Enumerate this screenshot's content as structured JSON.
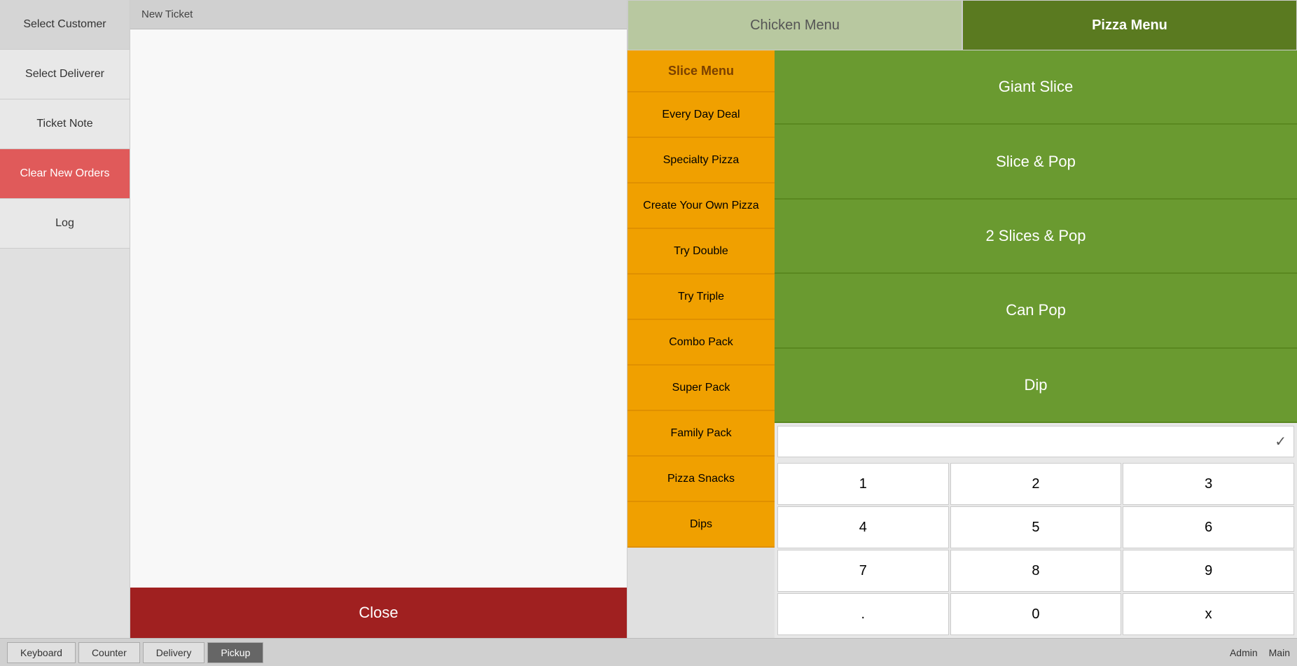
{
  "sidebar": {
    "buttons": [
      {
        "label": "Select Customer",
        "id": "select-customer",
        "active": false
      },
      {
        "label": "Select Deliverer",
        "id": "select-deliverer",
        "active": false
      },
      {
        "label": "Ticket Note",
        "id": "ticket-note",
        "active": false
      },
      {
        "label": "Clear New Orders",
        "id": "clear-new-orders",
        "active": true
      },
      {
        "label": "Log",
        "id": "log",
        "active": false
      }
    ]
  },
  "ticket": {
    "header": "New Ticket"
  },
  "close_btn": "Close",
  "menu_tabs": [
    {
      "label": "Chicken Menu",
      "active": false
    },
    {
      "label": "Pizza Menu",
      "active": true
    }
  ],
  "slice_menu": {
    "header": "Slice Menu",
    "items": [
      "Every Day Deal",
      "Specialty Pizza",
      "Create Your Own Pizza",
      "Try Double",
      "Try Triple",
      "Combo Pack",
      "Super Pack",
      "Family Pack",
      "Pizza Snacks",
      "Dips"
    ]
  },
  "menu_items": [
    "Giant Slice",
    "Slice & Pop",
    "2 Slices & Pop",
    "Can Pop",
    "Dip"
  ],
  "numpad": {
    "keys": [
      "1",
      "2",
      "3",
      "4",
      "5",
      "6",
      "7",
      "8",
      "9",
      ".",
      "0",
      "x"
    ],
    "display_value": ""
  },
  "bottom_tabs": [
    {
      "label": "Keyboard",
      "active": false
    },
    {
      "label": "Counter",
      "active": false
    },
    {
      "label": "Delivery",
      "active": false
    },
    {
      "label": "Pickup",
      "active": true
    }
  ],
  "bottom_right": {
    "admin": "Admin",
    "main": "Main"
  }
}
